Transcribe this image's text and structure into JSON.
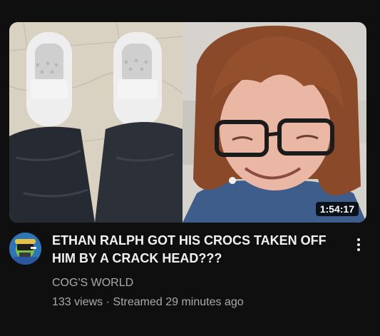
{
  "video": {
    "duration": "1:54:17",
    "title": "ETHAN RALPH GOT HIS CROCS TAKEN OFF HIM BY A CRACK HEAD???",
    "channel": "COG'S WORLD",
    "views": "133 views",
    "separator": "·",
    "streamed": "Streamed 29 minutes ago"
  },
  "icons": {
    "more": "more-vert-icon"
  },
  "colors": {
    "background": "#0f0f0f",
    "title": "#f1f1f1",
    "secondary_text": "#aaaaaa",
    "duration_badge": "#000000"
  }
}
